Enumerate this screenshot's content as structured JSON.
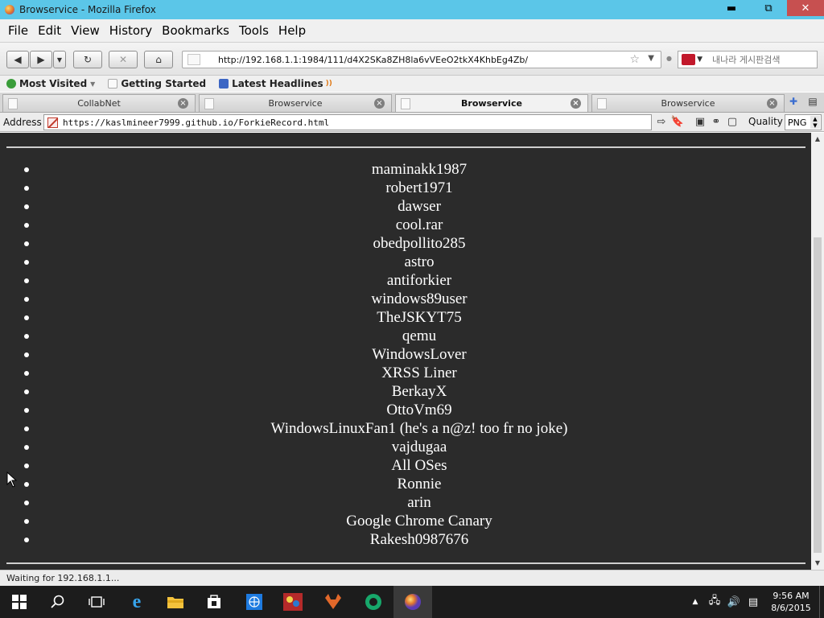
{
  "window": {
    "title": "Browservice - Mozilla Firefox",
    "minimize_glyph": "▬",
    "maximize_glyph": "⧉",
    "close_glyph": "✕"
  },
  "menu": [
    "File",
    "Edit",
    "View",
    "History",
    "Bookmarks",
    "Tools",
    "Help"
  ],
  "nav": {
    "back_icon": "back-arrow-icon",
    "forward_icon": "forward-arrow-icon",
    "reload_icon": "reload-icon",
    "stop_icon": "stop-icon",
    "home_icon": "home-icon",
    "url": "http://192.168.1.1:1984/111/d4X2SKa8ZH8la6vVEeO2tkX4KhbEg4Zb/",
    "search_placeholder": "내나라 게시판검색"
  },
  "bookmarks": [
    {
      "label": "Most Visited",
      "icon": "most-visited-icon",
      "color": "#3a9d3a"
    },
    {
      "label": "Getting Started",
      "icon": "page-icon",
      "color": "#f5f5f5"
    },
    {
      "label": "Latest Headlines",
      "icon": "rss-feed-icon",
      "color": "#3c66c4"
    }
  ],
  "tabs": [
    {
      "label": "CollabNet",
      "active": false
    },
    {
      "label": "Browservice",
      "active": false
    },
    {
      "label": "Browservice",
      "active": true
    },
    {
      "label": "Browservice",
      "active": false
    }
  ],
  "address": {
    "label": "Address",
    "url": "https://kaslmineer7999.github.io/ForkieRecord.html",
    "quality_label": "Quality",
    "quality_value": "PNG"
  },
  "page": {
    "background": "#2b2b2b",
    "names": [
      "maminakk1987",
      "robert1971",
      "dawser",
      "cool.rar",
      "obedpollito285",
      "astro",
      "antiforkier",
      "windows89user",
      "TheJSKYT75",
      "qemu",
      "WindowsLover",
      "XRSS Liner",
      "BerkayX",
      "OttoVm69",
      "WindowsLinuxFan1 (he's a n@z! too fr no joke)",
      "vajdugaa",
      "All OSes",
      "Ronnie",
      "arin",
      "Google Chrome Canary",
      "Rakesh0987676"
    ]
  },
  "status": {
    "text": "Waiting for 192.168.1.1..."
  },
  "taskbar": {
    "time": "9:56 AM",
    "date": "8/6/2015"
  }
}
